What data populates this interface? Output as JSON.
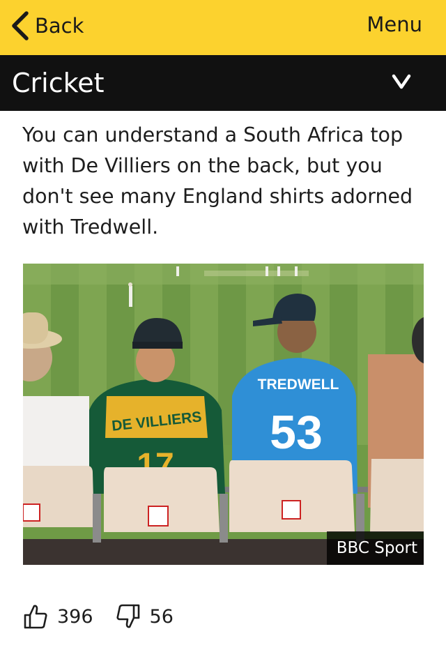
{
  "header": {
    "back_label": "Back",
    "menu_label": "Menu",
    "background_color": "#fcd22e"
  },
  "section": {
    "title": "Cricket",
    "background_color": "#111111",
    "toggle_icon": "chevron-down-icon"
  },
  "article": {
    "paragraph": "You can understand a South Africa top with De Villiers on the back, but you don't see many England shirts adorned with Tredwell."
  },
  "photo": {
    "credit": "BBC Sport",
    "shirt_left_name": "DE VILLIERS",
    "shirt_left_number": "17",
    "shirt_right_name": "TREDWELL",
    "shirt_right_number": "53"
  },
  "reactions": {
    "like_icon": "thumbs-up-icon",
    "like_count": "396",
    "dislike_icon": "thumbs-down-icon",
    "dislike_count": "56"
  }
}
